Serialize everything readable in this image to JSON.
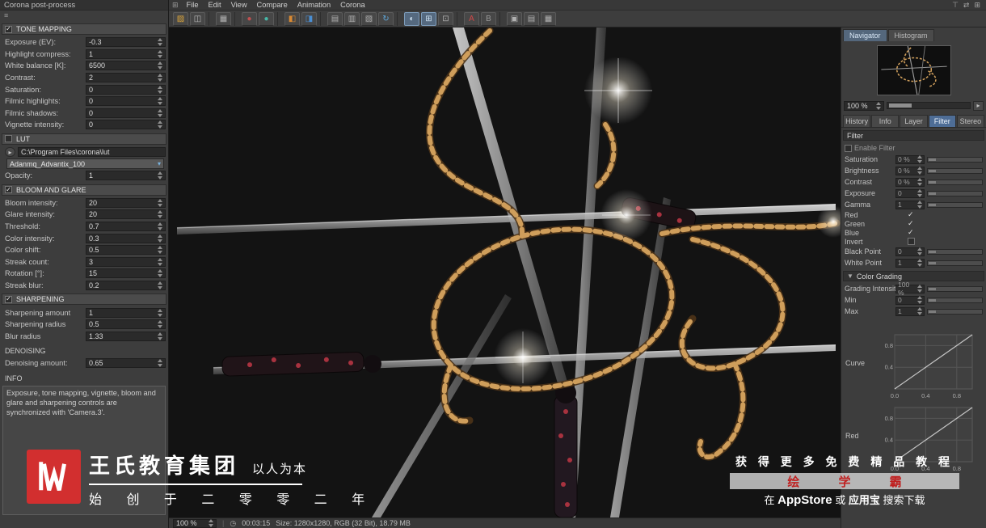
{
  "colors": {
    "accent_blue": "#4e6d96",
    "logo_red": "#d22f2f",
    "brand_red": "#c01f1f",
    "chain_gold": "#cf9e5b"
  },
  "left_panel": {
    "title": "Corona post-process",
    "sections": [
      {
        "header": "TONE MAPPING",
        "check": "on",
        "items": [
          {
            "t": "field",
            "label": "Exposure (EV):",
            "value": "-0.3"
          },
          {
            "t": "field",
            "label": "Highlight compress:",
            "value": "1"
          },
          {
            "t": "field",
            "label": "White balance [K]:",
            "value": "6500"
          },
          {
            "t": "field",
            "label": "Contrast:",
            "value": "2"
          },
          {
            "t": "field",
            "label": "Saturation:",
            "value": "0"
          },
          {
            "t": "field",
            "label": "Filmic highlights:",
            "value": "0"
          },
          {
            "t": "field",
            "label": "Filmic shadows:",
            "value": "0"
          },
          {
            "t": "field",
            "label": "Vignette intensity:",
            "value": "0"
          }
        ]
      },
      {
        "header": "LUT",
        "check": "off",
        "items": [
          {
            "t": "path",
            "value": "C:\\Program Files\\corona\\lut"
          },
          {
            "t": "select",
            "value": "Adanmq_Advantix_100"
          },
          {
            "t": "field",
            "label": "Opacity:",
            "value": "1"
          }
        ]
      },
      {
        "header": "BLOOM AND GLARE",
        "check": "on",
        "items": [
          {
            "t": "field",
            "label": "Bloom intensity:",
            "value": "20"
          },
          {
            "t": "field",
            "label": "Glare intensity:",
            "value": "20"
          },
          {
            "t": "field",
            "label": "Threshold:",
            "value": "0.7"
          },
          {
            "t": "field",
            "label": "Color intensity:",
            "value": "0.3"
          },
          {
            "t": "field",
            "label": "Color shift:",
            "value": "0.5"
          },
          {
            "t": "field",
            "label": "Streak count:",
            "value": "3"
          },
          {
            "t": "field",
            "label": "Rotation [°]:",
            "value": "15"
          },
          {
            "t": "field",
            "label": "Streak blur:",
            "value": "0.2"
          }
        ]
      },
      {
        "header": "SHARPENING",
        "check": "on",
        "items": [
          {
            "t": "field",
            "label": "Sharpening amount",
            "value": "1"
          },
          {
            "t": "field",
            "label": "Sharpening radius",
            "value": "0.5"
          },
          {
            "t": "field",
            "label": "Blur radius",
            "value": "1.33"
          }
        ]
      },
      {
        "header": "DENOISING",
        "check": "none",
        "items": [
          {
            "t": "field",
            "label": "Denoising amount:",
            "value": "0.65"
          }
        ]
      },
      {
        "header": "INFO",
        "check": "none",
        "items": [
          {
            "t": "info",
            "text": "Exposure, tone mapping, vignette, bloom and glare and sharpening controls are synchronized with 'Camera.3'."
          }
        ]
      }
    ]
  },
  "menubar": {
    "grid_glyph": "⊞",
    "items": [
      "File",
      "Edit",
      "View",
      "Compare",
      "Animation",
      "Corona"
    ],
    "corner_icons": [
      {
        "name": "pin-icon",
        "glyph": "⊤"
      },
      {
        "name": "arrange-icon",
        "glyph": "⇄"
      },
      {
        "name": "layout-grid-icon",
        "glyph": "⊞"
      }
    ]
  },
  "toolbar": {
    "icons": [
      {
        "name": "open-icon",
        "glyph": "▨",
        "color": "#d9a43c"
      },
      {
        "name": "save-icon",
        "glyph": "◫",
        "color": "#b8b8b8"
      },
      {
        "sep": true
      },
      {
        "name": "snapshot-icon",
        "glyph": "▦",
        "color": "#b0b0b0"
      },
      {
        "sep": true
      },
      {
        "name": "render-red-icon",
        "glyph": "●",
        "color": "#c05050"
      },
      {
        "name": "render-teal-icon",
        "glyph": "●",
        "color": "#47b8a8"
      },
      {
        "sep": true
      },
      {
        "name": "lightmix-icon",
        "glyph": "◧",
        "color": "#d98a33"
      },
      {
        "name": "fire-preview-icon",
        "glyph": "◨",
        "color": "#4a8fd4"
      },
      {
        "sep": true
      },
      {
        "name": "panel-history-icon",
        "glyph": "▤",
        "color": "#b0b0b0"
      },
      {
        "name": "panel-layers-icon",
        "glyph": "▥",
        "color": "#b0b0b0"
      },
      {
        "name": "panel-info-icon",
        "glyph": "▧",
        "color": "#b0b0b0"
      },
      {
        "name": "sync-icon",
        "glyph": "↻",
        "color": "#5fa8dc"
      },
      {
        "sep": true
      },
      {
        "name": "compare-split-icon",
        "glyph": "◐",
        "color": "#cfe2f2",
        "active": true
      },
      {
        "name": "compare-grid-icon",
        "glyph": "⊞",
        "color": "#cfe2f2",
        "active": true
      },
      {
        "name": "compare-swap-icon",
        "glyph": "⊡",
        "color": "#b0b0b0"
      },
      {
        "sep": true
      },
      {
        "name": "version-a-icon",
        "glyph": "A",
        "color": "#d04848"
      },
      {
        "name": "version-b-icon",
        "glyph": "B",
        "color": "#9a9a9a"
      },
      {
        "sep": true
      },
      {
        "name": "layout-1-icon",
        "glyph": "▣",
        "color": "#b0b0b0"
      },
      {
        "name": "layout-2-icon",
        "glyph": "▤",
        "color": "#b0b0b0"
      },
      {
        "name": "layout-3-icon",
        "glyph": "▦",
        "color": "#b0b0b0"
      }
    ]
  },
  "statusbar": {
    "zoom": "100 %",
    "clock_glyph": "◷",
    "time": "00:03:15",
    "info": "Size: 1280x1280, RGB (32 Bit), 18.79 MB"
  },
  "right_panel": {
    "nav_tabs": [
      {
        "label": "Navigator",
        "active": true
      },
      {
        "label": "Histogram",
        "active": false
      }
    ],
    "zoom_value": "100 %",
    "tabs": [
      {
        "label": "History"
      },
      {
        "label": "Info"
      },
      {
        "label": "Layer"
      },
      {
        "label": "Filter",
        "active": true
      },
      {
        "label": "Stereo"
      }
    ],
    "filter": {
      "header": "Filter",
      "enable_label": "Enable Filter",
      "sliders": [
        {
          "label": "Saturation",
          "value": "0 %"
        },
        {
          "label": "Brightness",
          "value": "0 %"
        },
        {
          "label": "Contrast",
          "value": "0 %"
        },
        {
          "label": "Exposure",
          "value": "0"
        },
        {
          "label": "Gamma",
          "value": "1"
        }
      ],
      "channels": [
        {
          "label": "Red",
          "mark": "✓"
        },
        {
          "label": "Green",
          "mark": "✓"
        },
        {
          "label": "Blue",
          "mark": "✓"
        },
        {
          "label": "Invert",
          "mark": "box"
        }
      ],
      "points": [
        {
          "label": "Black Point",
          "value": "0"
        },
        {
          "label": "White Point",
          "value": "1"
        }
      ]
    },
    "color_grading": {
      "header": "Color Grading",
      "collapse_glyph": "▼",
      "rows": [
        {
          "label": "Grading Intensity",
          "value": "100 %"
        },
        {
          "label": "Min",
          "value": "0"
        },
        {
          "label": "Max",
          "value": "1"
        }
      ]
    },
    "curves": [
      {
        "label": "Curve",
        "y_ticks": [
          "0.8",
          "0.4"
        ],
        "x_ticks": [
          "0.0",
          "0.4",
          "0.8"
        ]
      },
      {
        "label": "Red",
        "y_ticks": [
          "0.8",
          "0.4"
        ],
        "x_ticks": [
          "0.0",
          "0.4",
          "0.8"
        ]
      }
    ]
  },
  "watermarks": {
    "left": {
      "title": "王氏教育集团",
      "slogan": "以人为本",
      "bottom": "始 创 于 二 零 零 二 年"
    },
    "right": {
      "line1": "获 得 更 多 免 费 精 品 教 程",
      "bar": "绘 学 霸",
      "r3_pre": "在",
      "r3_app": "AppStore",
      "r3_mid": "或",
      "r3_store": "应用宝",
      "r3_post": "搜索下载"
    }
  }
}
